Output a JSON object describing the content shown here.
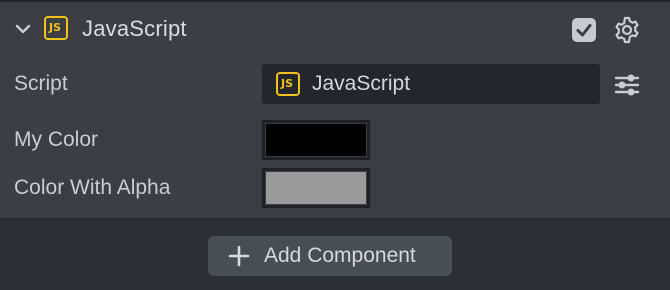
{
  "component": {
    "title": "JavaScript",
    "badge_text": "JS",
    "icons": {
      "collapse": "chevron-down-icon",
      "enabled": "checkbox-checked-icon",
      "settings": "gear-icon"
    },
    "enabled": true
  },
  "properties": {
    "script": {
      "label": "Script",
      "value": "JavaScript",
      "badge_text": "JS",
      "options_icon": "sliders-icon"
    },
    "my_color": {
      "label": "My Color",
      "color": "#000000"
    },
    "color_with_alpha": {
      "label": "Color With Alpha",
      "color": "#9a9a9b"
    }
  },
  "add_component": {
    "label": "Add Component",
    "icon": "plus-icon"
  },
  "colors": {
    "panel_bg": "#3b3e43",
    "page_bg": "#2c2f33",
    "field_bg": "#23262a",
    "js_accent": "#f2c21a",
    "button_bg": "#494e55"
  }
}
